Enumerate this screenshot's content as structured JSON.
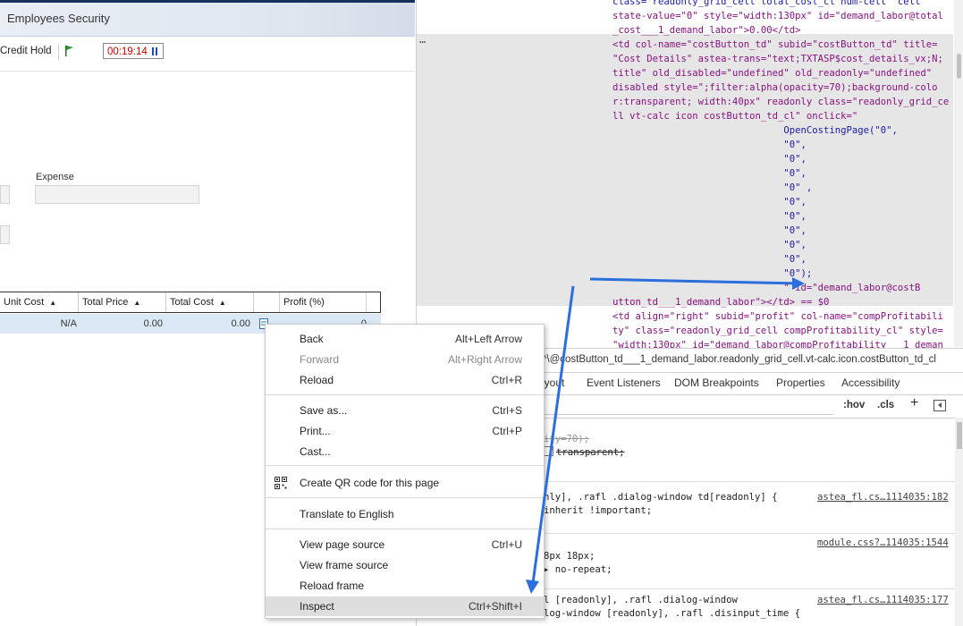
{
  "app": {
    "title": "Employees Security",
    "credit_hold": "Credit Hold",
    "timer": "00:19:14",
    "expense_label": "Expense",
    "grid": {
      "columns": [
        {
          "label": "Unit Cost",
          "sort": "▲"
        },
        {
          "label": "Total Price",
          "sort": "▲"
        },
        {
          "label": "Total Cost",
          "sort": "▲"
        },
        {
          "label": "",
          "sort": ""
        },
        {
          "label": "Profit (%)",
          "sort": ""
        }
      ],
      "row": [
        "N/A",
        "0.00",
        "0.00",
        "0"
      ]
    }
  },
  "devtools": {
    "source_lines": [
      {
        "text": "class=\"readonly_grid_cell total_cost_cl num-cell\" cell",
        "kind": "val"
      },
      {
        "text": "state-value=\"0\" style=\"width:130px\" id=\"demand_labor@total",
        "kind": "tag"
      },
      {
        "text": "_cost___1_demand_labor\">0.00</td>",
        "kind": "tag"
      },
      {
        "text": "<td col-name=\"costButton_td\" subid=\"costButton_td\" title=",
        "kind": "tag"
      },
      {
        "text": "\"Cost Details\" astea-trans=\"text;TXTASP$cost_details_vx;N;",
        "kind": "tag"
      },
      {
        "text": "title\" old_disabled=\"undefined\" old_readonly=\"undefined\"",
        "kind": "tag"
      },
      {
        "text": "disabled style=\";filter:alpha(opacity=70);background-colo",
        "kind": "tag"
      },
      {
        "text": "r:transparent; width:40px\" readonly class=\"readonly_grid_ce",
        "kind": "tag"
      },
      {
        "text": "ll vt-calc icon costButton_td_cl\" onclick=\"",
        "kind": "tag"
      },
      {
        "text": "                              OpenCostingPage(\"0\",",
        "kind": "val"
      },
      {
        "text": "                              \"0\",",
        "kind": "val"
      },
      {
        "text": "                              \"0\",",
        "kind": "val"
      },
      {
        "text": "                              \"0\",",
        "kind": "val"
      },
      {
        "text": "                              \"0\" ,",
        "kind": "val"
      },
      {
        "text": "                              \"0\",",
        "kind": "val"
      },
      {
        "text": "                              \"0\",",
        "kind": "val"
      },
      {
        "text": "                              \"0\",",
        "kind": "val"
      },
      {
        "text": "                              \"0\",",
        "kind": "val"
      },
      {
        "text": "                              \"0\",",
        "kind": "val"
      },
      {
        "text": "                              \"0\");",
        "kind": "val"
      },
      {
        "text": "                              \" id=\"demand_labor@costB",
        "kind": "tag"
      },
      {
        "text": "utton_td___1_demand_labor\"></td> == $0",
        "kind": "tag"
      },
      {
        "text": "<td align=\"right\" subid=\"profit\" col-name=\"compProfitabili",
        "kind": "tag"
      },
      {
        "text": "ty\" class=\"readonly_grid_cell compProfitability_cl\" style=",
        "kind": "tag"
      },
      {
        "text": "\"width:130px\" id=\"demand_labor@compProfitability___1_deman",
        "kind": "tag"
      }
    ],
    "ellipsis": "…",
    "breadcrumb": "^\\@costButton_td___1_demand_labor.readonly_grid_cell.vt-calc.icon.costButton_td_cl",
    "tabs": [
      "ayout",
      "Event Listeners",
      "DOM Breakpoints",
      "Properties",
      "Accessibility"
    ],
    "hov": ":hov",
    "cls": ".cls",
    "plus": "+",
    "rules": [
      {
        "lines": [
          "ity=70);",
          "transparent;"
        ],
        "source": ""
      },
      {
        "lines": [
          "nly], .rafl .dialog-window td[readonly] {",
          "inherit !important;"
        ],
        "source": "astea_fl.cs…1114035:182"
      },
      {
        "lines": [
          "8px 18px;",
          "▸ no-repeat;"
        ],
        "source": "module.css?…114035:1544"
      },
      {
        "lines": [
          "l [readonly], .rafl .dialog-window",
          "log-window [readonly], .rafl .disinput_time {"
        ],
        "source": "astea_fl.cs…1114035:177"
      }
    ]
  },
  "context_menu": {
    "items": [
      {
        "label": "Back",
        "shortcut": "Alt+Left Arrow",
        "state": "normal"
      },
      {
        "label": "Forward",
        "shortcut": "Alt+Right Arrow",
        "state": "disabled"
      },
      {
        "label": "Reload",
        "shortcut": "Ctrl+R",
        "state": "normal"
      },
      {
        "label": "Save as...",
        "shortcut": "Ctrl+S",
        "state": "normal"
      },
      {
        "label": "Print...",
        "shortcut": "Ctrl+P",
        "state": "normal"
      },
      {
        "label": "Cast...",
        "shortcut": "",
        "state": "normal"
      },
      {
        "label": "Create QR code for this page",
        "shortcut": "",
        "state": "normal",
        "icon": "qr-code-icon"
      },
      {
        "label": "Translate to English",
        "shortcut": "",
        "state": "normal"
      },
      {
        "label": "View page source",
        "shortcut": "Ctrl+U",
        "state": "normal"
      },
      {
        "label": "View frame source",
        "shortcut": "",
        "state": "normal"
      },
      {
        "label": "Reload frame",
        "shortcut": "",
        "state": "normal"
      },
      {
        "label": "Inspect",
        "shortcut": "Ctrl+Shift+I",
        "state": "active"
      }
    ]
  },
  "colors": {
    "annotation_arrow": "#2a6fdb",
    "tag": "#881280",
    "timer_text": "#cc0000"
  }
}
